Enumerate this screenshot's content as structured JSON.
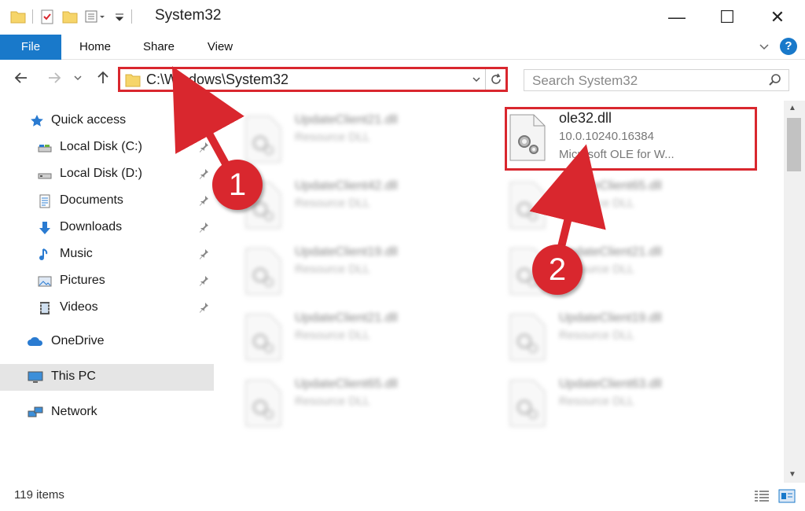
{
  "window": {
    "title": "System32",
    "minimize": "—",
    "maximize": "☐",
    "close": "✕"
  },
  "ribbon": {
    "tabs": [
      "File",
      "Home",
      "Share",
      "View"
    ]
  },
  "address": {
    "path": "C:\\Windows\\System32",
    "search_placeholder": "Search System32"
  },
  "sidebar": {
    "items": [
      {
        "label": "Quick access",
        "icon": "star-icon"
      },
      {
        "label": "Local Disk (C:)",
        "icon": "drive-icon",
        "pinned": true
      },
      {
        "label": "Local Disk (D:)",
        "icon": "drive-icon",
        "pinned": true
      },
      {
        "label": "Documents",
        "icon": "documents-icon",
        "pinned": true
      },
      {
        "label": "Downloads",
        "icon": "download-icon",
        "pinned": true
      },
      {
        "label": "Music",
        "icon": "music-icon",
        "pinned": true
      },
      {
        "label": "Pictures",
        "icon": "pictures-icon",
        "pinned": true
      },
      {
        "label": "Videos",
        "icon": "videos-icon",
        "pinned": true
      },
      {
        "label": "OneDrive",
        "icon": "cloud-icon"
      },
      {
        "label": "This PC",
        "icon": "computer-icon",
        "selected": true
      },
      {
        "label": "Network",
        "icon": "network-icon"
      }
    ]
  },
  "files": {
    "highlighted": {
      "name": "ole32.dll",
      "version": "10.0.10240.16384",
      "description": "Microsoft OLE for W..."
    },
    "left_column": [
      {
        "name": "UpdateClient21.dll",
        "type": "Resource DLL"
      },
      {
        "name": "UpdateClient42.dll",
        "type": "Resource DLL"
      },
      {
        "name": "UpdateClient19.dll",
        "type": "Resource DLL"
      },
      {
        "name": "UpdateClient21.dll",
        "type": "Resource DLL"
      },
      {
        "name": "UpdateClient65.dll",
        "type": "Resource DLL"
      }
    ],
    "right_column": [
      {
        "name": "UpdateClient65.dll",
        "type": "Resource DLL"
      },
      {
        "name": "UpdateClient21.dll",
        "type": "Resource DLL"
      },
      {
        "name": "UpdateClient19.dll",
        "type": "Resource DLL"
      },
      {
        "name": "UpdateClient63.dll",
        "type": "Resource DLL"
      }
    ]
  },
  "status": {
    "item_count": "119 items"
  },
  "annotations": {
    "step1": "1",
    "step2": "2",
    "color": "#d9272e"
  },
  "colors": {
    "accent": "#1979ca",
    "highlight": "#d9272e"
  }
}
